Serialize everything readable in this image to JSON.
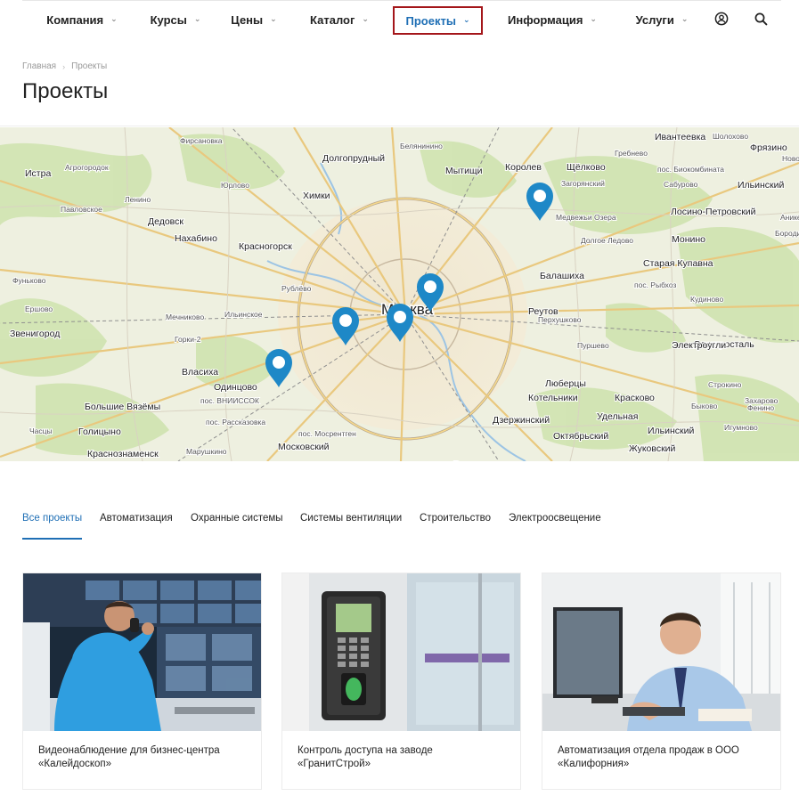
{
  "nav": {
    "items": [
      {
        "label": "Компания",
        "active": false
      },
      {
        "label": "Курсы",
        "active": false
      },
      {
        "label": "Цены",
        "active": false
      },
      {
        "label": "Каталог",
        "active": false
      },
      {
        "label": "Проекты",
        "active": true
      },
      {
        "label": "Информация",
        "active": false
      },
      {
        "label": "Услуги",
        "active": false
      }
    ],
    "icons": [
      "user-icon",
      "search-icon"
    ]
  },
  "breadcrumb": {
    "home": "Главная",
    "current": "Проекты"
  },
  "page": {
    "title": "Проекты"
  },
  "map": {
    "center_label": "Москва",
    "labels": [
      "Фирсановка",
      "Долгопрудный",
      "Белянинино",
      "Мытищи",
      "Королев",
      "Щёлково",
      "Гребнево",
      "Фрязино",
      "Истра",
      "Агрогородок",
      "Юрлово",
      "Химки",
      "Ивантеевка",
      "Загорянский",
      "пос. Биокомбината",
      "Павловское",
      "Ленино",
      "Лосино-Петровский",
      "Дедовск",
      "Нахабино",
      "Медвежьи Озера",
      "Красногорск",
      "Монино",
      "Балашиха",
      "Старая Купавна",
      "Аникеево",
      "Ильинский",
      "Сабурово",
      "Фуньково",
      "Рублёво",
      "Реутов",
      "пос. Рыбхоз",
      "Кудиново",
      "Электросталь",
      "Ершово",
      "Мечниково",
      "Ильинское",
      "Звенигород",
      "Горки-2",
      "Перхушково",
      "Пуршево",
      "Электроугли",
      "Власиха",
      "Одинцово",
      "Москва",
      "Люберцы",
      "Котельники",
      "Красково",
      "Строкино",
      "Большие Вязёмы",
      "Голицыно",
      "пос. ВНИИССОК",
      "Дзержинский",
      "Удельная",
      "Ильинский",
      "Часцы",
      "пос. Рассказовка",
      "пос. Мосрентген",
      "Октябрьский",
      "Краснознаменск",
      "Московский",
      "Жуковский",
      "Развилка",
      "Лыткарино",
      "Марушкино",
      "Быково",
      "Фенино",
      "Долгое Ледово",
      "Бородино",
      "Игумново",
      "Захарово",
      "Шолохово",
      "Новое"
    ],
    "pins": 5
  },
  "tabs": [
    {
      "label": "Все проекты",
      "active": true
    },
    {
      "label": "Автоматизация",
      "active": false
    },
    {
      "label": "Охранные системы",
      "active": false
    },
    {
      "label": "Системы вентиляции",
      "active": false
    },
    {
      "label": "Строительство",
      "active": false
    },
    {
      "label": "Электроосвещение",
      "active": false
    }
  ],
  "projects": [
    {
      "title": "Видеонаблюдение для бизнес-центра «Калейдоскоп»"
    },
    {
      "title": "Контроль доступа на заводе «ГранитСтрой»"
    },
    {
      "title": "Автоматизация отдела продаж в ООО «Калифорния»"
    }
  ],
  "colors": {
    "accent": "#1f6fb5",
    "active_border": "#a4161a",
    "pin": "#1e88c7"
  }
}
